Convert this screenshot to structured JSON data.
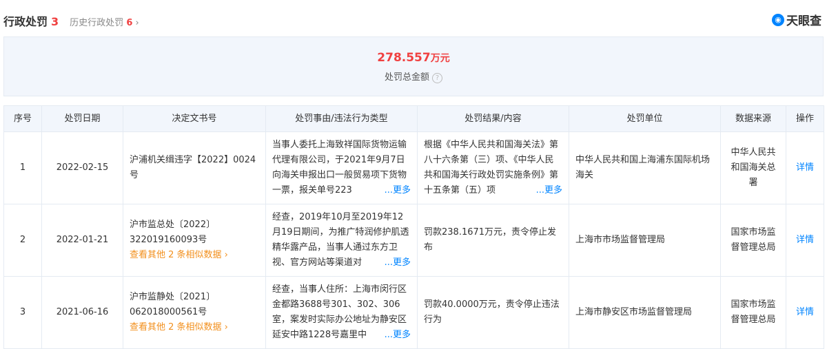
{
  "header": {
    "title": "行政处罚",
    "count": "3",
    "history_label": "历史行政处罚",
    "history_count": "6",
    "chevron": "›"
  },
  "logo": {
    "text": "天眼查"
  },
  "summary": {
    "amount": "278.557",
    "unit": "万元",
    "label": "处罚总金额",
    "help": "?"
  },
  "table": {
    "columns": [
      "序号",
      "处罚日期",
      "决定文书号",
      "处罚事由/违法行为类型",
      "处罚结果/内容",
      "处罚单位",
      "数据来源",
      "操作"
    ],
    "rows": [
      {
        "no": "1",
        "date": "2022-02-15",
        "doc": "沪浦机关缉违字【2022】0024号",
        "similar": "",
        "reason": "当事人委托上海致祥国际货物运输代理有限公司，于2021年9月7日向海关申报出口一般贸易项下货物一票，报关单号223",
        "result": "根据《中华人民共和国海关法》第八十六条第（三）项、《中华人民共和国海关行政处罚实施条例》第十五条第（五）项",
        "reason_more": "...更多",
        "result_more": "...更多",
        "unit": "中华人民共和国上海浦东国际机场海关",
        "source": "中华人民共和国海关总署",
        "action": "详情"
      },
      {
        "no": "2",
        "date": "2022-01-21",
        "doc": "沪市监总处〔2022〕322019160093号",
        "similar": "查看其他 2 条相似数据 ›",
        "reason": "经查，2019年10月至2019年12月19日期间，为推广特润修护肌透精华露产品，当事人通过东方卫视、官方网站等渠道对",
        "result": "罚款238.1671万元，责令停止发布",
        "reason_more": "...更多",
        "result_more": "",
        "unit": "上海市市场监督管理局",
        "source": "国家市场监督管理总局",
        "action": "详情"
      },
      {
        "no": "3",
        "date": "2021-06-16",
        "doc": "沪市监静处〔2021〕062018000561号",
        "similar": "查看其他 2 条相似数据 ›",
        "reason": "经查，当事人住所：上海市闵行区金都路3688号301、302、306室，案发时实际办公地址为静安区延安中路1228号嘉里中",
        "result": "罚款40.0000万元，责令停止违法行为",
        "reason_more": "...更多",
        "result_more": "",
        "unit": "上海市静安区市场监督管理局",
        "source": "国家市场监督管理总局",
        "action": "详情"
      }
    ]
  }
}
